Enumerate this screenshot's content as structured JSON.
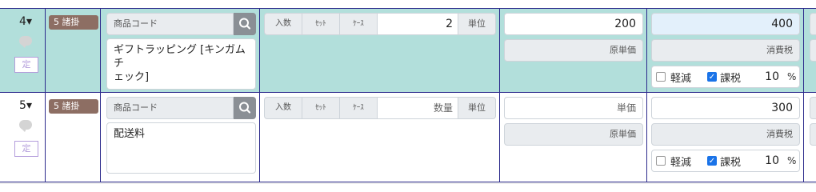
{
  "rows": [
    {
      "no": "4▾",
      "badge": "5 諸掛",
      "sticker": "定",
      "code_placeholder": "商品コード",
      "item_name_line1": "ギフトラッピング [キンガムチ",
      "item_name_line2": "ェック]",
      "qty_labels": [
        "入数",
        "ｾｯﾄ",
        "ｹｰｽ"
      ],
      "qty_value": "2",
      "unit_label": "単位",
      "unit_price": "200",
      "cost_label": "原単価",
      "amount": "400",
      "tax_label": "消費税",
      "reduced_label": "軽減",
      "reduced_checked": false,
      "taxable_label": "課税",
      "taxable_checked": true,
      "tax_rate": "10",
      "pct": "%",
      "edge_text": "価"
    },
    {
      "no": "5▾",
      "badge": "5 諸掛",
      "sticker": "定",
      "code_placeholder": "商品コード",
      "item_name_line1": "配送料",
      "item_name_line2": "",
      "qty_labels": [
        "入数",
        "ｾｯﾄ",
        "ｹｰｽ"
      ],
      "qty_value": "数量",
      "unit_label": "単位",
      "unit_price": "単価",
      "cost_label": "原単価",
      "amount": "300",
      "tax_label": "消費税",
      "reduced_label": "軽減",
      "reduced_checked": false,
      "taxable_label": "課税",
      "taxable_checked": true,
      "tax_rate": "10",
      "pct": "%",
      "edge_text": "価"
    }
  ],
  "colors": {
    "row_highlight": "#b2dfdb",
    "grid_line": "#2c2a8c",
    "badge": "#8d6e63",
    "amount_bg": "#e3f0fb",
    "checkbox_on": "#1a73e8"
  },
  "icons": {
    "search": "search-icon",
    "comment": "comment-icon",
    "check": "check-icon"
  }
}
